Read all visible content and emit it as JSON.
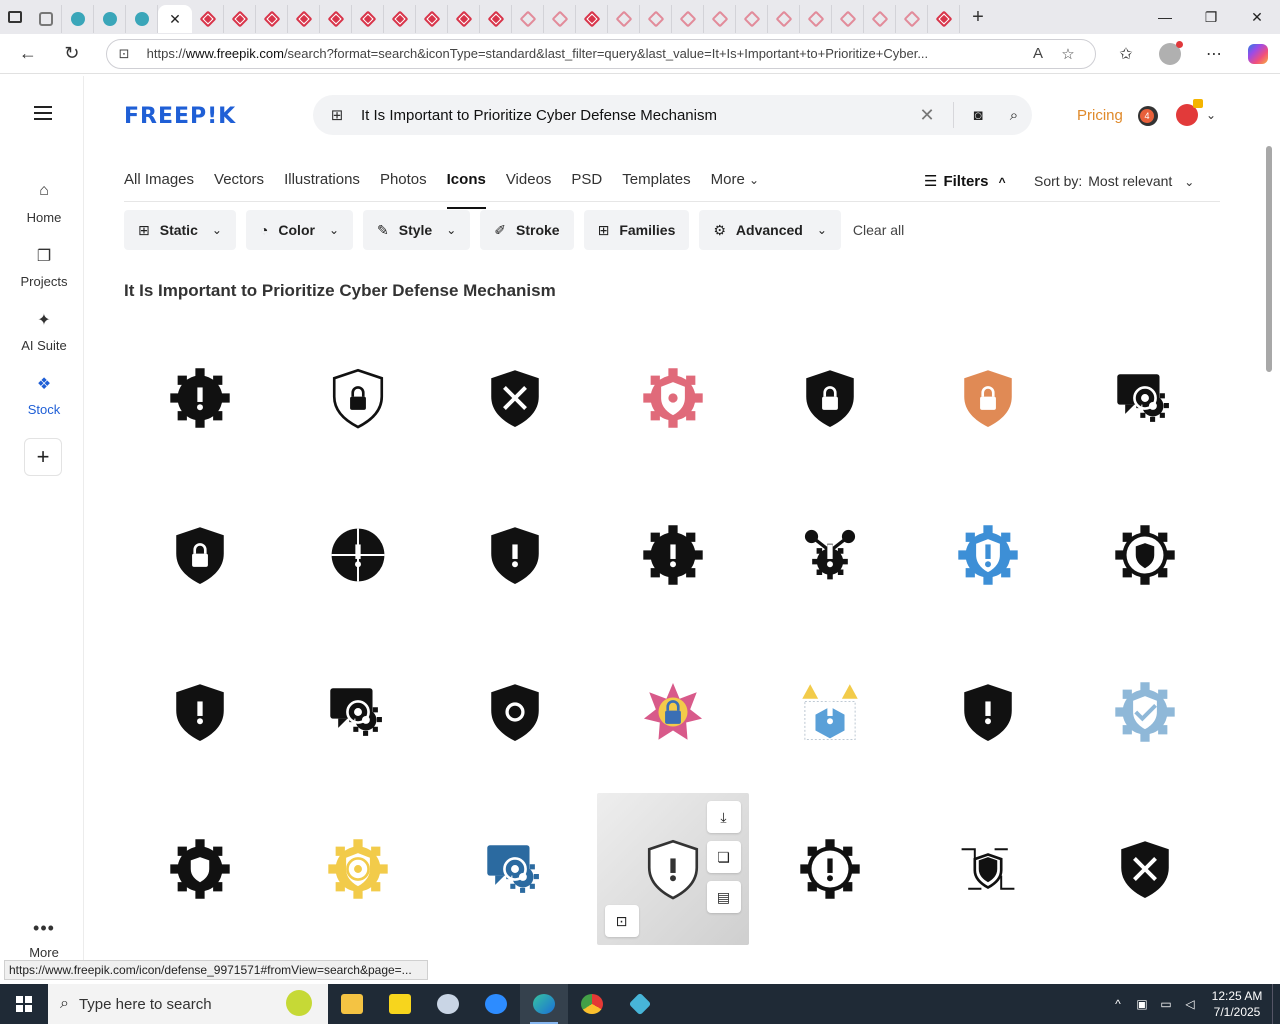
{
  "browser": {
    "url_prefix": "https://",
    "url_domain": "www.freepik.com",
    "url_rest": "/search?format=search&iconType=standard&last_filter=query&last_value=It+Is+Important+to+Prioritize+Cyber..."
  },
  "sidebar": {
    "items": [
      {
        "label": "Home",
        "icon": "home-icon"
      },
      {
        "label": "Projects",
        "icon": "projects-icon"
      },
      {
        "label": "AI Suite",
        "icon": "sparkle-icon"
      },
      {
        "label": "Stock",
        "icon": "stock-icon",
        "active": true
      }
    ],
    "more_label": "More"
  },
  "header": {
    "logo": "FREEP!K",
    "search_value": "It Is Important to Prioritize Cyber Defense Mechanism",
    "pricing": "Pricing",
    "notifications": "4"
  },
  "categories": [
    "All Images",
    "Vectors",
    "Illustrations",
    "Photos",
    "Icons",
    "Videos",
    "PSD",
    "Templates",
    "More"
  ],
  "active_category": "Icons",
  "toolbar": {
    "filters_label": "Filters",
    "sort_label": "Sort by:",
    "sort_value": "Most relevant"
  },
  "filter_chips": [
    {
      "label": "Static",
      "icon": "static-icon",
      "caret": true
    },
    {
      "label": "Color",
      "icon": "palette-icon",
      "caret": true
    },
    {
      "label": "Style",
      "icon": "brush-icon",
      "caret": true
    },
    {
      "label": "Stroke",
      "icon": "pen-icon",
      "caret": false
    },
    {
      "label": "Families",
      "icon": "families-icon",
      "caret": false
    },
    {
      "label": "Advanced",
      "icon": "gear-icon",
      "caret": true
    }
  ],
  "clear_all": "Clear all",
  "results_title": "It Is Important to Prioritize Cyber Defense Mechanism",
  "status_url": "https://www.freepik.com/icon/defense_9971571#fromView=search&page=...",
  "taskbar": {
    "search_placeholder": "Type here to search",
    "time": "12:25 AM",
    "date": "7/1/2025"
  },
  "icons": [
    {
      "kind": "gear",
      "fill": "#111",
      "glyph": "!"
    },
    {
      "kind": "shield-outline",
      "fill": "#111",
      "glyph": "lock"
    },
    {
      "kind": "shield",
      "fill": "#111",
      "glyph": "x"
    },
    {
      "kind": "gear-shield",
      "fill": "#e06a7a",
      "glyph": "dot"
    },
    {
      "kind": "shield",
      "fill": "#111",
      "glyph": "lock"
    },
    {
      "kind": "shield",
      "fill": "#e08a55",
      "glyph": "lock"
    },
    {
      "kind": "chat",
      "fill": "#111",
      "glyph": "target"
    },
    {
      "kind": "shield",
      "fill": "#111",
      "glyph": "lock"
    },
    {
      "kind": "globe",
      "fill": "#111",
      "glyph": "!"
    },
    {
      "kind": "shield",
      "fill": "#111",
      "glyph": "!"
    },
    {
      "kind": "gear",
      "fill": "#111",
      "glyph": "!"
    },
    {
      "kind": "nodes",
      "fill": "#111",
      "glyph": "!"
    },
    {
      "kind": "gear-shield",
      "fill": "#3d8fd6",
      "glyph": "!"
    },
    {
      "kind": "gear-outline",
      "fill": "#111",
      "glyph": "shield"
    },
    {
      "kind": "shield",
      "fill": "#111",
      "glyph": "!"
    },
    {
      "kind": "chat",
      "fill": "#111",
      "glyph": "target"
    },
    {
      "kind": "shield",
      "fill": "#111",
      "glyph": "gear"
    },
    {
      "kind": "star",
      "fill": "#d85a8a",
      "glyph": "lock"
    },
    {
      "kind": "warning-gear",
      "fill": "#5aa0d8",
      "glyph": "!"
    },
    {
      "kind": "shield",
      "fill": "#111",
      "glyph": "!"
    },
    {
      "kind": "gear-shield",
      "fill": "#8fb8d8",
      "glyph": "check"
    },
    {
      "kind": "gear",
      "fill": "#111",
      "glyph": "shield"
    },
    {
      "kind": "gear-shield",
      "fill": "#f2cb4a",
      "glyph": "target"
    },
    {
      "kind": "chat",
      "fill": "#2b6aa0",
      "glyph": "target"
    },
    {
      "kind": "shield-outline",
      "fill": "#333",
      "glyph": "!"
    },
    {
      "kind": "gear-outline",
      "fill": "#111",
      "glyph": "!"
    },
    {
      "kind": "circuit",
      "fill": "#111",
      "glyph": "shield"
    },
    {
      "kind": "shield",
      "fill": "#111",
      "glyph": "x"
    }
  ]
}
